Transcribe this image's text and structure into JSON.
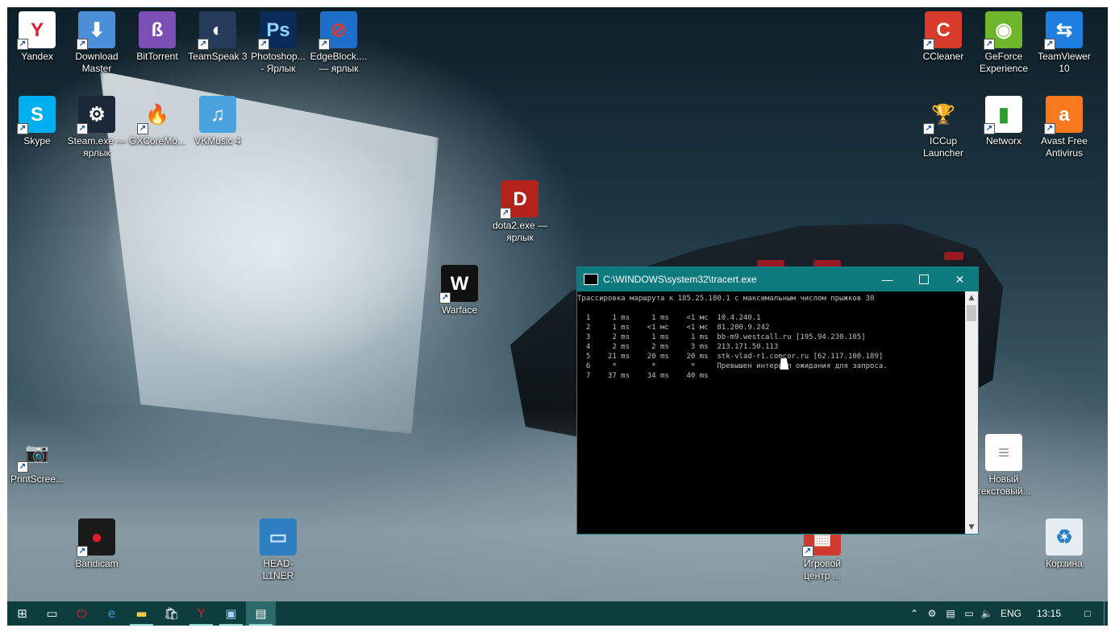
{
  "desktop": {
    "icons": [
      {
        "label": "Yandex",
        "glyph": "Y",
        "color": "#e21c2b",
        "bg": "#ffffff",
        "icon": "yandex-browser-icon",
        "shortcut": true
      },
      {
        "label": "Download Master",
        "glyph": "⬇",
        "color": "#ffffff",
        "bg": "#4b8fd9",
        "icon": "download-master-icon",
        "shortcut": true
      },
      {
        "label": "BitTorrent",
        "glyph": "ß",
        "color": "#ffffff",
        "bg": "#7b4fb3",
        "icon": "bittorrent-icon",
        "shortcut": false
      },
      {
        "label": "TeamSpeak 3",
        "glyph": "◐",
        "color": "#ffffff",
        "bg": "#243b5a",
        "icon": "teamspeak-icon",
        "shortcut": true
      },
      {
        "label": "Photoshop... - Ярлык",
        "glyph": "Ps",
        "color": "#8ed3ff",
        "bg": "#0a2a57",
        "icon": "photoshop-icon",
        "shortcut": true
      },
      {
        "label": "EdgeBlock.... — ярлык",
        "glyph": "⊘",
        "color": "#e0362e",
        "bg": "#1e6fc9",
        "icon": "edgeblock-icon",
        "shortcut": true
      },
      {
        "label": "CCleaner",
        "glyph": "C",
        "color": "#ffffff",
        "bg": "#d83b2a",
        "icon": "ccleaner-icon",
        "shortcut": true
      },
      {
        "label": "GeForce Experience",
        "glyph": "◉",
        "color": "#ffffff",
        "bg": "#6fb52c",
        "icon": "geforce-experience-icon",
        "shortcut": true
      },
      {
        "label": "TeamViewer 10",
        "glyph": "⇆",
        "color": "#ffffff",
        "bg": "#1f7fe0",
        "icon": "teamviewer-icon",
        "shortcut": true
      },
      {
        "label": "Skype",
        "glyph": "S",
        "color": "#ffffff",
        "bg": "#00aff0",
        "icon": "skype-icon",
        "shortcut": true
      },
      {
        "label": "Steam.exe — ярлык",
        "glyph": "⚙",
        "color": "#ffffff",
        "bg": "#1b2838",
        "icon": "steam-icon",
        "shortcut": true
      },
      {
        "label": "GXCoreMo...",
        "glyph": "🔥",
        "color": "#3b6cff",
        "bg": "transparent",
        "icon": "gxcore-icon",
        "shortcut": true
      },
      {
        "label": "VKMusic 4",
        "glyph": "♫",
        "color": "#ffffff",
        "bg": "#4aa3df",
        "icon": "vkmusic-icon",
        "shortcut": false
      },
      {
        "label": "ICCup Launcher",
        "glyph": "🏆",
        "color": "#e7c04a",
        "bg": "transparent",
        "icon": "iccup-icon",
        "shortcut": true
      },
      {
        "label": "Networx",
        "glyph": "▮",
        "color": "#2d9b2d",
        "bg": "#ffffff",
        "icon": "networx-icon",
        "shortcut": true
      },
      {
        "label": "Avast Free Antivirus",
        "glyph": "a",
        "color": "#ffffff",
        "bg": "#f7781d",
        "icon": "avast-icon",
        "shortcut": true
      },
      {
        "label": "dota2.exe — ярлык",
        "glyph": "D",
        "color": "#ffffff",
        "bg": "#b3231c",
        "icon": "dota2-icon",
        "shortcut": true
      },
      {
        "label": "Warface",
        "glyph": "W",
        "color": "#ffffff",
        "bg": "#111111",
        "icon": "warface-icon",
        "shortcut": true
      },
      {
        "label": "PrintScree...",
        "glyph": "📷",
        "color": "#333333",
        "bg": "transparent",
        "icon": "camera-icon",
        "shortcut": true
      },
      {
        "label": "Новый текстовый...",
        "glyph": "≡",
        "color": "#9a9a9a",
        "bg": "#ffffff",
        "icon": "text-document-icon",
        "shortcut": false
      },
      {
        "label": "Bandicam",
        "glyph": "●",
        "color": "#e21c2b",
        "bg": "#1a1a1a",
        "icon": "bandicam-icon",
        "shortcut": true
      },
      {
        "label": "HEAD-L1NER",
        "glyph": "▭",
        "color": "#bfe3ff",
        "bg": "#2d7fc1",
        "icon": "computer-icon",
        "shortcut": false
      },
      {
        "label": "Игровой центр ...",
        "glyph": "▦",
        "color": "#ffffff",
        "bg": "#d03a2c",
        "icon": "game-center-icon",
        "shortcut": true
      },
      {
        "label": "Корзина",
        "glyph": "♻",
        "color": "#2a7fc2",
        "bg": "#e6eef3",
        "icon": "recycle-bin-icon",
        "shortcut": false
      }
    ]
  },
  "console": {
    "title": "C:\\WINDOWS\\system32\\tracert.exe",
    "lines": [
      "Трассировка маршрута к 185.25.180.1 с максимальным числом прыжков 30",
      "",
      "  1     1 ms     1 ms    <1 мс  10.4.240.1",
      "  2     1 ms    <1 мс    <1 мс  81.200.9.242",
      "  3     2 ms     1 ms     1 ms  bb-m9.westcall.ru [195.94.230.105]",
      "  4     2 ms     2 ms     3 ms  213.171.50.113",
      "  5    21 ms    20 ms    20 ms  stk-vlad-r1.comcor.ru [62.117.100.189]",
      "  6     *        *        *     Превышен интервал ожидания для запроса.",
      "  7    37 ms    34 ms    40 ms"
    ],
    "minimize_icon": "minimize-icon",
    "maximize_icon": "maximize-icon",
    "close_icon": "close-icon"
  },
  "taskbar": {
    "buttons": [
      {
        "icon": "windows-start-icon",
        "glyph": "⊞",
        "color": "#ffffff"
      },
      {
        "icon": "task-view-icon",
        "glyph": "▭",
        "color": "#ffffff"
      },
      {
        "icon": "power-app-icon",
        "glyph": "⏻",
        "color": "#e21c2b"
      },
      {
        "icon": "edge-icon",
        "glyph": "e",
        "color": "#3aa0f3"
      },
      {
        "icon": "file-explorer-icon",
        "glyph": "▬",
        "color": "#f2c94c"
      },
      {
        "icon": "store-icon",
        "glyph": "🛍",
        "color": "#ffffff"
      },
      {
        "icon": "yandex-taskbar-icon",
        "glyph": "Y",
        "color": "#e21c2b"
      },
      {
        "icon": "photos-icon",
        "glyph": "▣",
        "color": "#9fd0ff"
      },
      {
        "icon": "console-taskbar-icon",
        "glyph": "▤",
        "color": "#ffffff"
      }
    ],
    "tray": {
      "chevron_icon": "chevron-up-icon",
      "language": "ENG",
      "time": "13:15"
    }
  }
}
